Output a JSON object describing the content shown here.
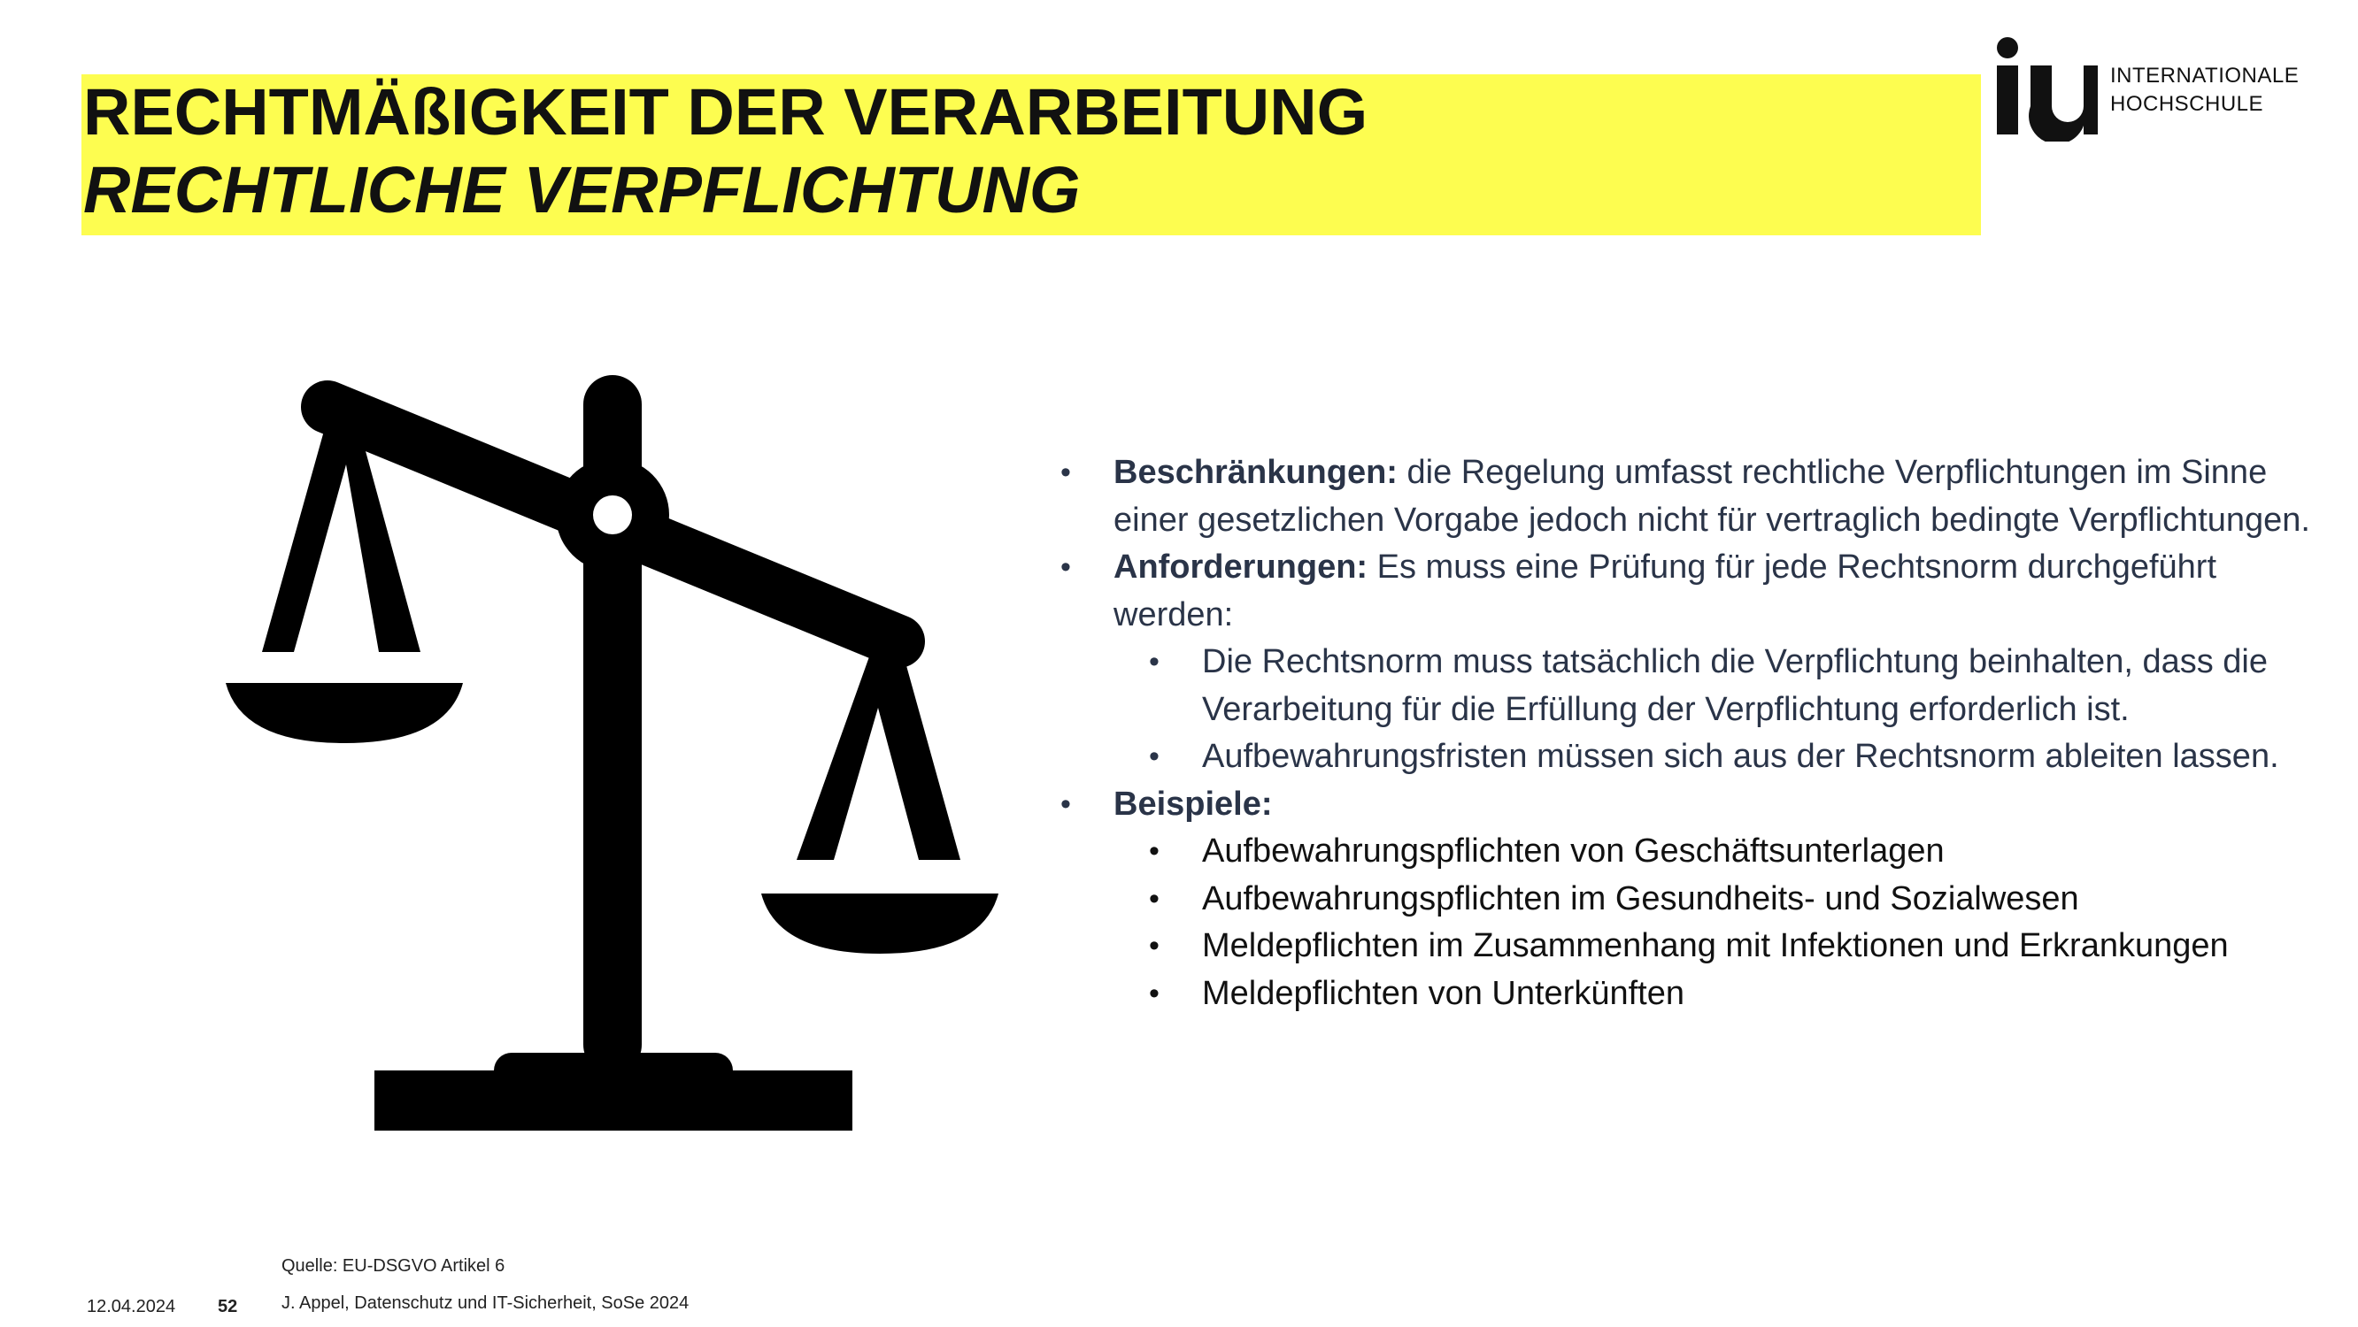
{
  "slide": {
    "title_line1": "RECHTMÄßIGKEIT DER VERARBEITUNG",
    "title_line2": "RECHTLICHE VERPFLICHTUNG"
  },
  "logo": {
    "mark": "iu",
    "line1": "INTERNATIONALE",
    "line2": "HOCHSCHULE"
  },
  "illustration": {
    "icon": "scales-of-justice-icon",
    "color": "#000000"
  },
  "content": {
    "items": [
      {
        "term": "Beschränkungen:",
        "text": " die Regelung umfasst rechtliche Verpflichtungen im Sinne einer gesetzlichen Vorgabe jedoch nicht für vertraglich bedingte Verpflichtungen."
      },
      {
        "term": "Anforderungen:",
        "text": " Es muss eine Prüfung für jede Rechtsnorm durchgeführt werden:",
        "sub": [
          "Die Rechtsnorm muss tatsächlich die Verpflichtung beinhalten, dass die Verarbeitung für die Erfüllung der Verpflichtung erforderlich ist.",
          "Aufbewahrungsfristen müssen sich aus der Rechtsnorm ableiten lassen."
        ]
      },
      {
        "term": "Beispiele:",
        "sub": [
          "Aufbewahrungspflichten von Geschäftsunterlagen",
          "Aufbewahrungspflichten im Gesundheits- und Sozialwesen",
          "Meldepflichten im Zusammenhang mit Infektionen und Erkrankungen",
          "Meldepflichten von Unterkünften"
        ]
      }
    ]
  },
  "footer": {
    "source": "Quelle: EU-DSGVO Artikel 6",
    "date": "12.04.2024",
    "page": "52",
    "author": "J. Appel, Datenschutz und IT-Sicherheit, SoSe 2024"
  },
  "colors": {
    "title_bar": "#fdfd50",
    "body_text": "#2a3448"
  }
}
